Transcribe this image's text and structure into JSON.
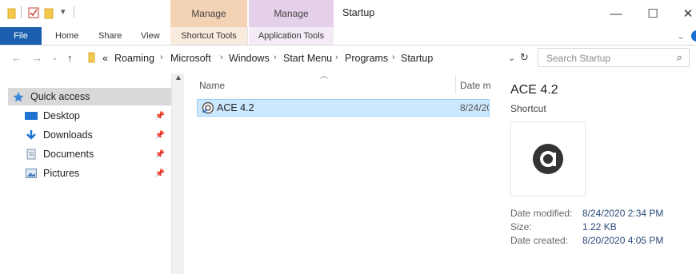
{
  "window": {
    "title": "Startup",
    "minimize": "—",
    "maximize": "☐",
    "close": "✕"
  },
  "contextual_groups": [
    {
      "header": "Manage",
      "tab": "Shortcut Tools",
      "color": "#f4d3b4"
    },
    {
      "header": "Manage",
      "tab": "Application Tools",
      "color": "#e5d0ea"
    }
  ],
  "ribbon_tabs": [
    "File",
    "Home",
    "Share",
    "View"
  ],
  "address": {
    "overflow": "«",
    "crumbs": [
      "Roaming",
      "Microsoft",
      "Windows",
      "Start Menu",
      "Programs",
      "Startup"
    ]
  },
  "search": {
    "placeholder": "Search Startup"
  },
  "nav": {
    "quick_access": "Quick access",
    "items": [
      {
        "label": "Desktop",
        "icon": "desktop-icon"
      },
      {
        "label": "Downloads",
        "icon": "download-arrow-icon"
      },
      {
        "label": "Documents",
        "icon": "documents-icon"
      },
      {
        "label": "Pictures",
        "icon": "pictures-icon"
      }
    ]
  },
  "columns": {
    "name": "Name",
    "date": "Date m"
  },
  "files": [
    {
      "name": "ACE 4.2",
      "date": "8/24/20",
      "icon": "ace-shortcut-icon"
    }
  ],
  "preview": {
    "title": "ACE 4.2",
    "type": "Shortcut",
    "date_modified_label": "Date modified:",
    "date_modified": "8/24/2020 2:34 PM",
    "size_label": "Size:",
    "size": "1.22 KB",
    "date_created_label": "Date created:",
    "date_created": "8/20/2020 4:05 PM"
  },
  "colors": {
    "accent": "#1c5fae",
    "selection": "#cce8ff"
  }
}
